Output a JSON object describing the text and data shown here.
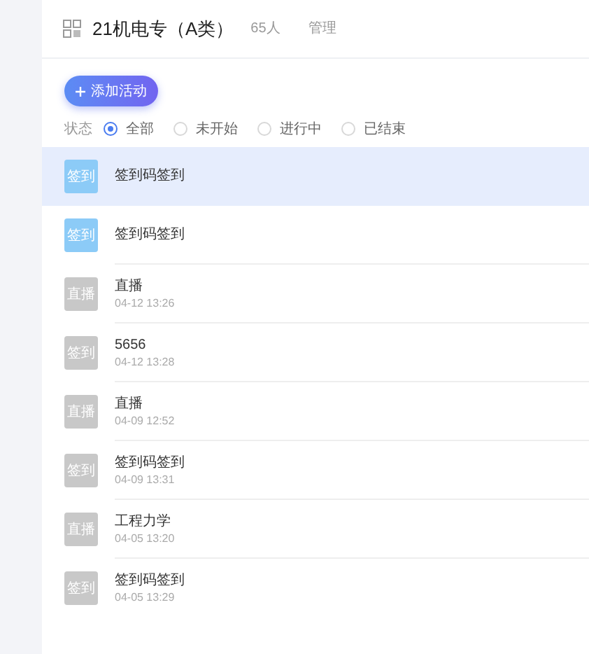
{
  "header": {
    "title": "21机电专（A类）",
    "count": "65人",
    "manage": "管理"
  },
  "add_button": "添加活动",
  "filter": {
    "label": "状态",
    "options": [
      {
        "label": "全部",
        "selected": true
      },
      {
        "label": "未开始",
        "selected": false
      },
      {
        "label": "进行中",
        "selected": false
      },
      {
        "label": "已结束",
        "selected": false
      }
    ]
  },
  "activities": [
    {
      "badge": "签到",
      "title": "签到码签到",
      "active": true,
      "selected": true
    },
    {
      "badge": "签到",
      "title": "签到码签到",
      "active": true,
      "selected": false
    },
    {
      "badge": "直播",
      "title": "直播",
      "time": "04-12 13:26",
      "active": false,
      "selected": false
    },
    {
      "badge": "签到",
      "title": "5656",
      "time": "04-12 13:28",
      "active": false,
      "selected": false
    },
    {
      "badge": "直播",
      "title": "直播",
      "time": "04-09 12:52",
      "active": false,
      "selected": false
    },
    {
      "badge": "签到",
      "title": "签到码签到",
      "time": "04-09 13:31",
      "active": false,
      "selected": false
    },
    {
      "badge": "直播",
      "title": "工程力学",
      "time": "04-05 13:20",
      "active": false,
      "selected": false
    },
    {
      "badge": "签到",
      "title": "签到码签到",
      "time": "04-05 13:29",
      "active": false,
      "selected": false
    }
  ]
}
